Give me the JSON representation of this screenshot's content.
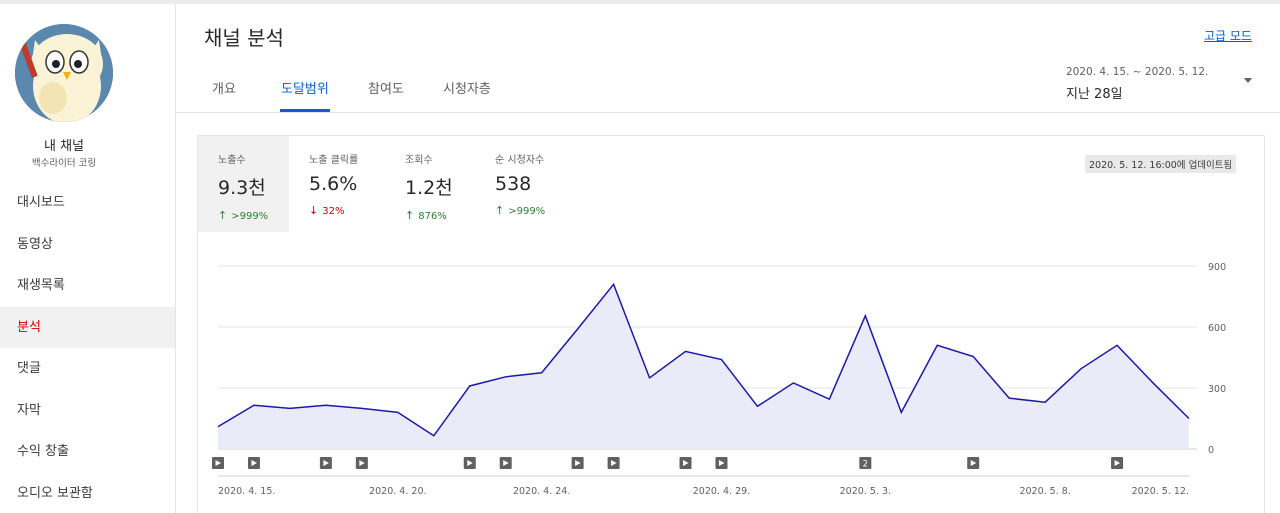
{
  "sidebar": {
    "channel_label": "내 채널",
    "channel_name": "백수라이터 코링",
    "items": [
      {
        "label": "대시보드"
      },
      {
        "label": "동영상"
      },
      {
        "label": "재생목록"
      },
      {
        "label": "분석"
      },
      {
        "label": "댓글"
      },
      {
        "label": "자막"
      },
      {
        "label": "수익 창출"
      },
      {
        "label": "오디오 보관함"
      }
    ],
    "active_index": 3
  },
  "header": {
    "title": "채널 분석",
    "advanced_mode": "고급 모드",
    "tabs": [
      {
        "label": "개요"
      },
      {
        "label": "도달범위"
      },
      {
        "label": "참여도"
      },
      {
        "label": "시청자층"
      }
    ],
    "active_tab": 1,
    "date_range": "2020. 4. 15. ~ 2020. 5. 12.",
    "period": "지난 28일"
  },
  "card": {
    "updated": "2020. 5. 12. 16:00에 업데이트됨",
    "metrics": [
      {
        "label": "노출수",
        "value": "9.3천",
        "delta": ">999%",
        "direction": "up"
      },
      {
        "label": "노출 클릭률",
        "value": "5.6%",
        "delta": "32%",
        "direction": "down"
      },
      {
        "label": "조회수",
        "value": "1.2천",
        "delta": "876%",
        "direction": "up"
      },
      {
        "label": "순 시청자수",
        "value": "538",
        "delta": ">999%",
        "direction": "up"
      }
    ]
  },
  "colors": {
    "accent": "#065fd4",
    "line": "#1a1aa6",
    "area": "#eaeaf8",
    "active_nav": "#cc0000",
    "up": "#2f7d32",
    "down": "#cc0000"
  },
  "chart_data": {
    "type": "area",
    "x": [
      "2020-04-15",
      "2020-04-16",
      "2020-04-17",
      "2020-04-18",
      "2020-04-19",
      "2020-04-20",
      "2020-04-21",
      "2020-04-22",
      "2020-04-23",
      "2020-04-24",
      "2020-04-25",
      "2020-04-26",
      "2020-04-27",
      "2020-04-28",
      "2020-04-29",
      "2020-04-30",
      "2020-05-01",
      "2020-05-02",
      "2020-05-03",
      "2020-05-04",
      "2020-05-05",
      "2020-05-06",
      "2020-05-07",
      "2020-05-08",
      "2020-05-09",
      "2020-05-10",
      "2020-05-11",
      "2020-05-12"
    ],
    "series": [
      {
        "values": [
          110,
          215,
          200,
          215,
          200,
          180,
          65,
          310,
          355,
          375,
          590,
          810,
          350,
          480,
          440,
          210,
          325,
          245,
          655,
          180,
          510,
          455,
          250,
          230,
          395,
          510,
          325,
          150
        ]
      }
    ],
    "ylim": [
      0,
      900
    ],
    "yticks": [
      "900",
      "600",
      "300",
      "0"
    ],
    "xtick_labels": [
      "2020. 4. 15.",
      "2020. 4. 20.",
      "2020. 4. 24.",
      "2020. 4. 29.",
      "2020. 5. 3.",
      "2020. 5. 8.",
      "2020. 5. 12."
    ],
    "xtick_days": [
      0,
      5,
      9,
      14,
      18,
      23,
      27
    ],
    "video_markers": [
      {
        "day": 0,
        "icon": "play-icon"
      },
      {
        "day": 1,
        "icon": "play-icon"
      },
      {
        "day": 3,
        "icon": "play-icon"
      },
      {
        "day": 4,
        "icon": "play-icon"
      },
      {
        "day": 7,
        "icon": "play-icon"
      },
      {
        "day": 8,
        "icon": "play-icon"
      },
      {
        "day": 10,
        "icon": "play-icon"
      },
      {
        "day": 11,
        "icon": "play-icon"
      },
      {
        "day": 13,
        "icon": "play-icon"
      },
      {
        "day": 14,
        "icon": "play-icon"
      },
      {
        "day": 18,
        "icon": "count-badge",
        "label": "2"
      },
      {
        "day": 21,
        "icon": "play-icon"
      },
      {
        "day": 25,
        "icon": "play-icon"
      }
    ],
    "grid": true
  }
}
